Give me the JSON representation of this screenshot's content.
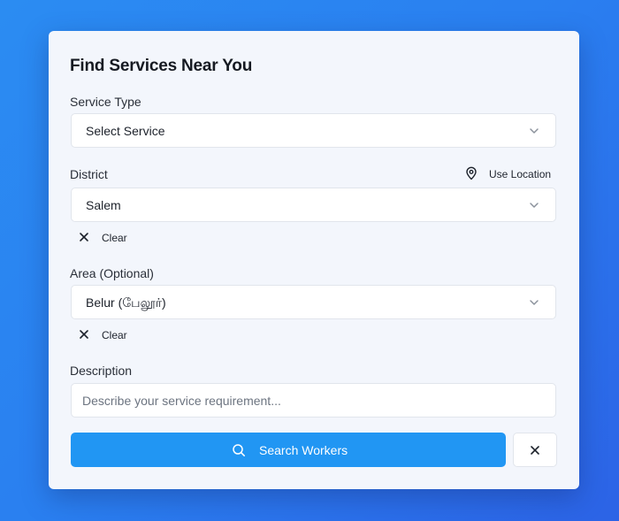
{
  "form": {
    "title": "Find Services Near You",
    "service_type": {
      "label": "Service Type",
      "value": "Select Service",
      "icon": "chevron-down-icon"
    },
    "district": {
      "label": "District",
      "value": "Salem",
      "use_location_label": "Use Location",
      "use_location_icon": "map-pin-icon",
      "clear_label": "Clear",
      "icon": "chevron-down-icon"
    },
    "area": {
      "label": "Area (Optional)",
      "value": "Belur (பேலூர்)",
      "clear_label": "Clear",
      "icon": "chevron-down-icon"
    },
    "description": {
      "label": "Description",
      "value": "",
      "placeholder": "Describe your service requirement..."
    },
    "search_button": {
      "label": "Search Workers",
      "icon": "search-icon"
    },
    "close_button": {
      "icon": "close-icon"
    }
  },
  "colors": {
    "background_gradient_start": "#2b8cf2",
    "background_gradient_end": "#2c63e6",
    "card": "#f3f6fc",
    "primary_button": "#2196f3",
    "field_border": "#e1e5ec"
  }
}
